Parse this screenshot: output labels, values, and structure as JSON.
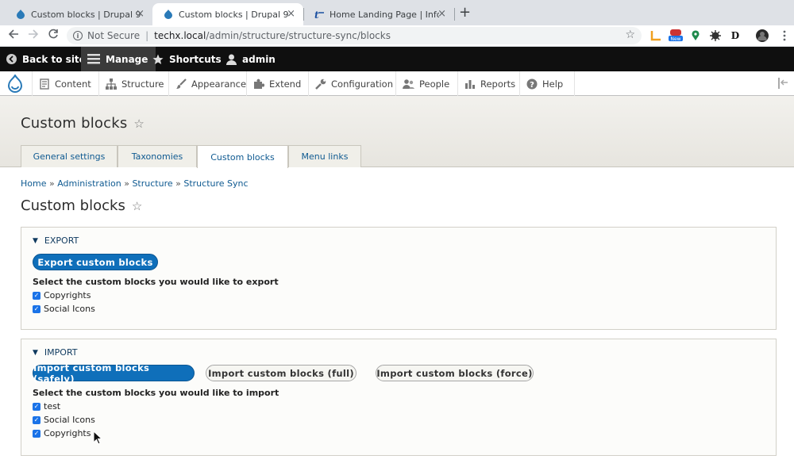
{
  "browser": {
    "tabs": [
      {
        "title": "Custom blocks | Drupal 9",
        "active": false,
        "favicon": "drupal-icon"
      },
      {
        "title": "Custom blocks | Drupal 9",
        "active": true,
        "favicon": "drupal-icon"
      },
      {
        "title": "Home Landing Page | Informat",
        "active": false,
        "favicon": "landing-icon"
      }
    ],
    "close_glyph": "×",
    "newtab_glyph": "+",
    "address": {
      "security": "Not Secure",
      "separator": "|",
      "host": "techx.local",
      "path": "/admin/structure/structure-sync/blocks"
    },
    "extension_badge": "New"
  },
  "admin_toolbar": {
    "back": "Back to site",
    "manage": "Manage",
    "shortcuts": "Shortcuts",
    "user": "admin"
  },
  "tray": {
    "items": [
      "Content",
      "Structure",
      "Appearance",
      "Extend",
      "Configuration",
      "People",
      "Reports",
      "Help"
    ]
  },
  "header": {
    "title": "Custom blocks",
    "tabs": [
      "General settings",
      "Taxonomies",
      "Custom blocks",
      "Menu links"
    ],
    "active_tab": "Custom blocks"
  },
  "breadcrumb": {
    "items": [
      "Home",
      "Administration",
      "Structure",
      "Structure Sync"
    ],
    "sep": "»"
  },
  "main": {
    "title": "Custom blocks",
    "export": {
      "legend": "EXPORT",
      "button": "Export custom blocks",
      "description": "Select the custom blocks you would like to export",
      "items": [
        "Copyrights",
        "Social Icons"
      ]
    },
    "import": {
      "legend": "IMPORT",
      "buttons": [
        "Import custom blocks (safely)",
        "Import custom blocks (full)",
        "Import custom blocks (force)"
      ],
      "description": "Select the custom blocks you would like to import",
      "items": [
        "test",
        "Social Icons",
        "Copyrights"
      ]
    }
  },
  "colors": {
    "accent": "#0f6fba",
    "link": "#0f5a91",
    "toolbar": "#0f0f0f"
  }
}
